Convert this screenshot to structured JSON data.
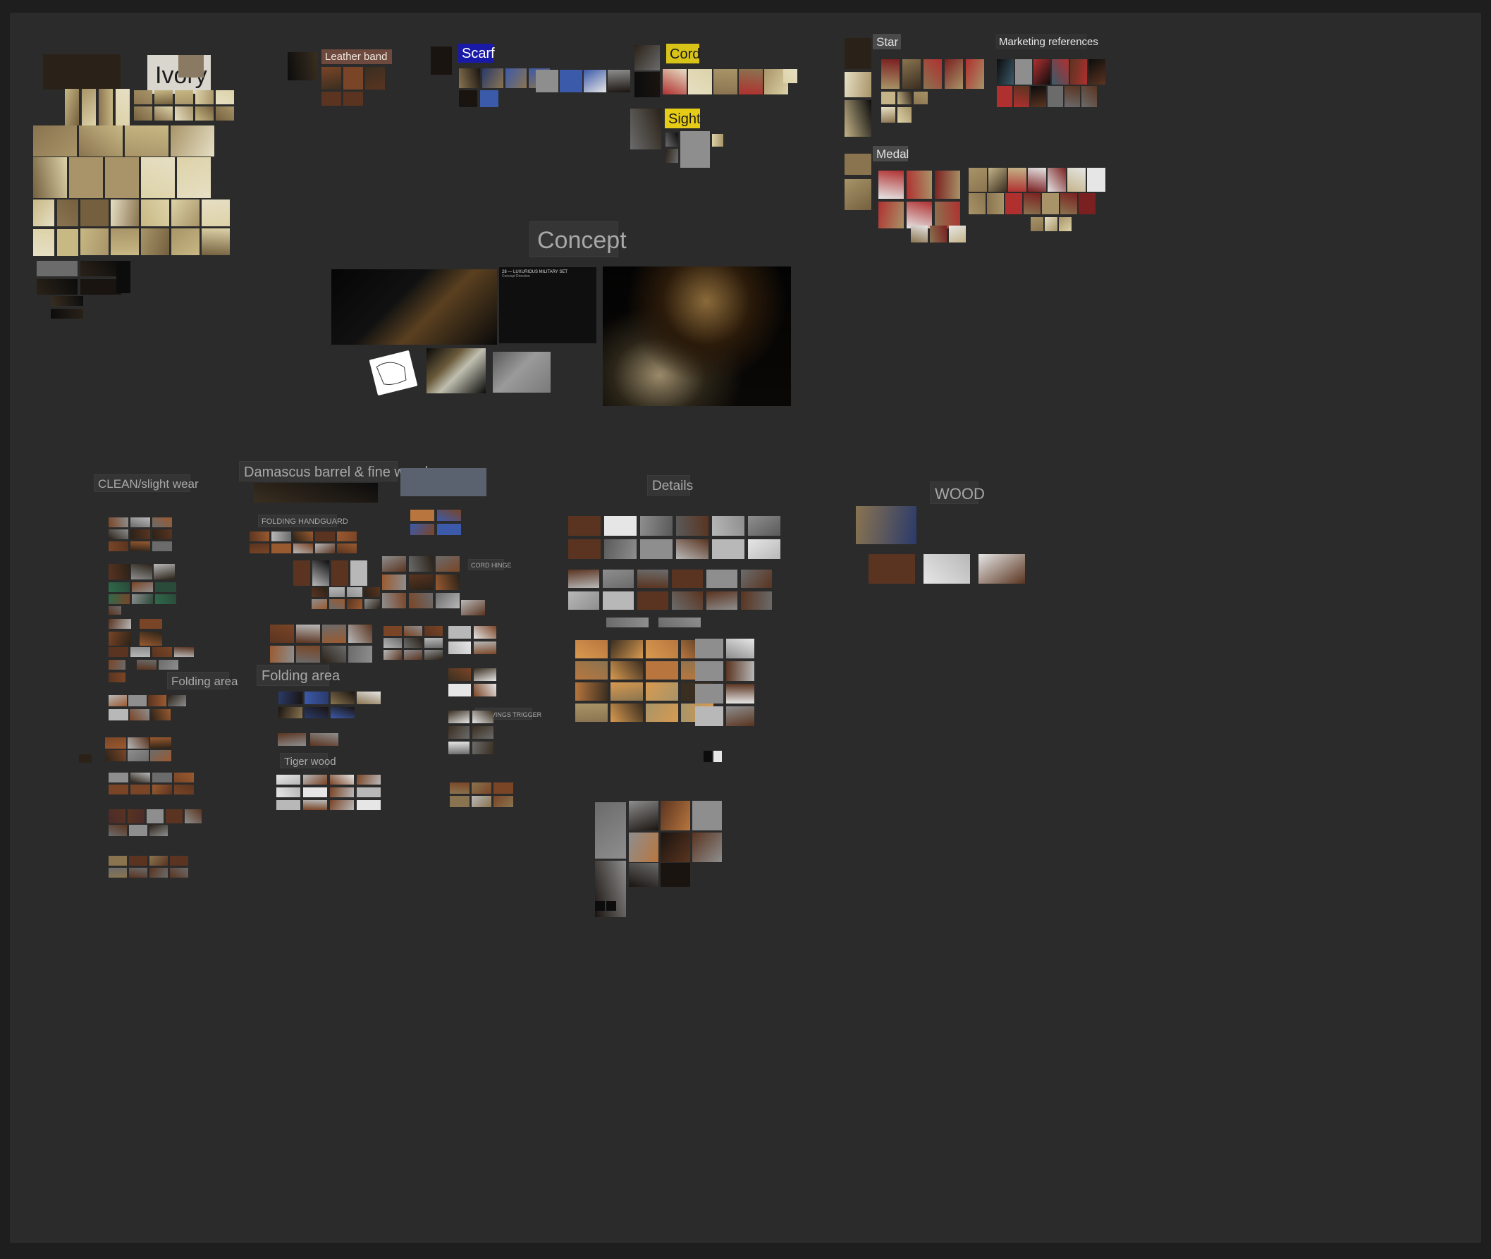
{
  "board": {
    "background": "#2b2b2b",
    "frame": "#1e1e1e"
  },
  "palette": [
    "#0c0c0c",
    "#1a1410",
    "#2a2218",
    "#3a2e20",
    "#4a3a26",
    "#5e4a30",
    "#74603e",
    "#8a7450",
    "#a89468",
    "#c4b488",
    "#ddd2a8",
    "#6b6b6b",
    "#8e8e8e",
    "#b8b8b8",
    "#e6e6e6",
    "#5a3420",
    "#7a4526",
    "#9a5a30",
    "#b8763e",
    "#d89a50",
    "#3a3f4a",
    "#5a6270",
    "#2a3a6a",
    "#3c5aaa",
    "#4a2a2a",
    "#7a2020",
    "#b03030",
    "#2a4a3a",
    "#2e6a4a"
  ],
  "labels": {
    "ivory": "Ivory",
    "leather_band": "Leather band",
    "scarf": "Scarf",
    "cord": "Cord",
    "sight": "Sight",
    "star": "Star",
    "marketing": "Marketing references",
    "medal": "Medal",
    "concept": "Concept",
    "clean": "CLEAN/slight wear",
    "damascus": "Damascus barrel & fine wood",
    "details": "Details",
    "wood": "WOOD",
    "folding_handguard": "FOLDING HANDGUARD",
    "cord_hinge": "CORD HINGE",
    "folding_area_1": "Folding area",
    "folding_area_2": "Folding area",
    "carvings_trigger": "CARVINGS TRIGGER",
    "tiger_wood": "Tiger wood"
  },
  "label_colors": {
    "ivory": {
      "bg": "#d9d6cd",
      "fg": "#1c1c1c"
    },
    "leather_band": {
      "bg": "#6e4a3e",
      "fg": "#f0e8e0"
    },
    "scarf": {
      "bg": "#1a1aa8",
      "fg": "#ffffff"
    },
    "cord": {
      "bg": "#d8c418",
      "fg": "#1a1a1a"
    },
    "sight": {
      "bg": "#e6cc16",
      "fg": "#1a1a1a"
    },
    "star": {
      "bg": "#4a4a4a",
      "fg": "#e0e0e0"
    },
    "marketing": {
      "bg": "#323232",
      "fg": "#e8e8e8"
    },
    "medal": {
      "bg": "#4a4a4a",
      "fg": "#e0e0e0"
    }
  },
  "concept_doc": {
    "title": "28 — LUXURIOUS MILITARY SET",
    "subtitle": "Concept Direction"
  }
}
